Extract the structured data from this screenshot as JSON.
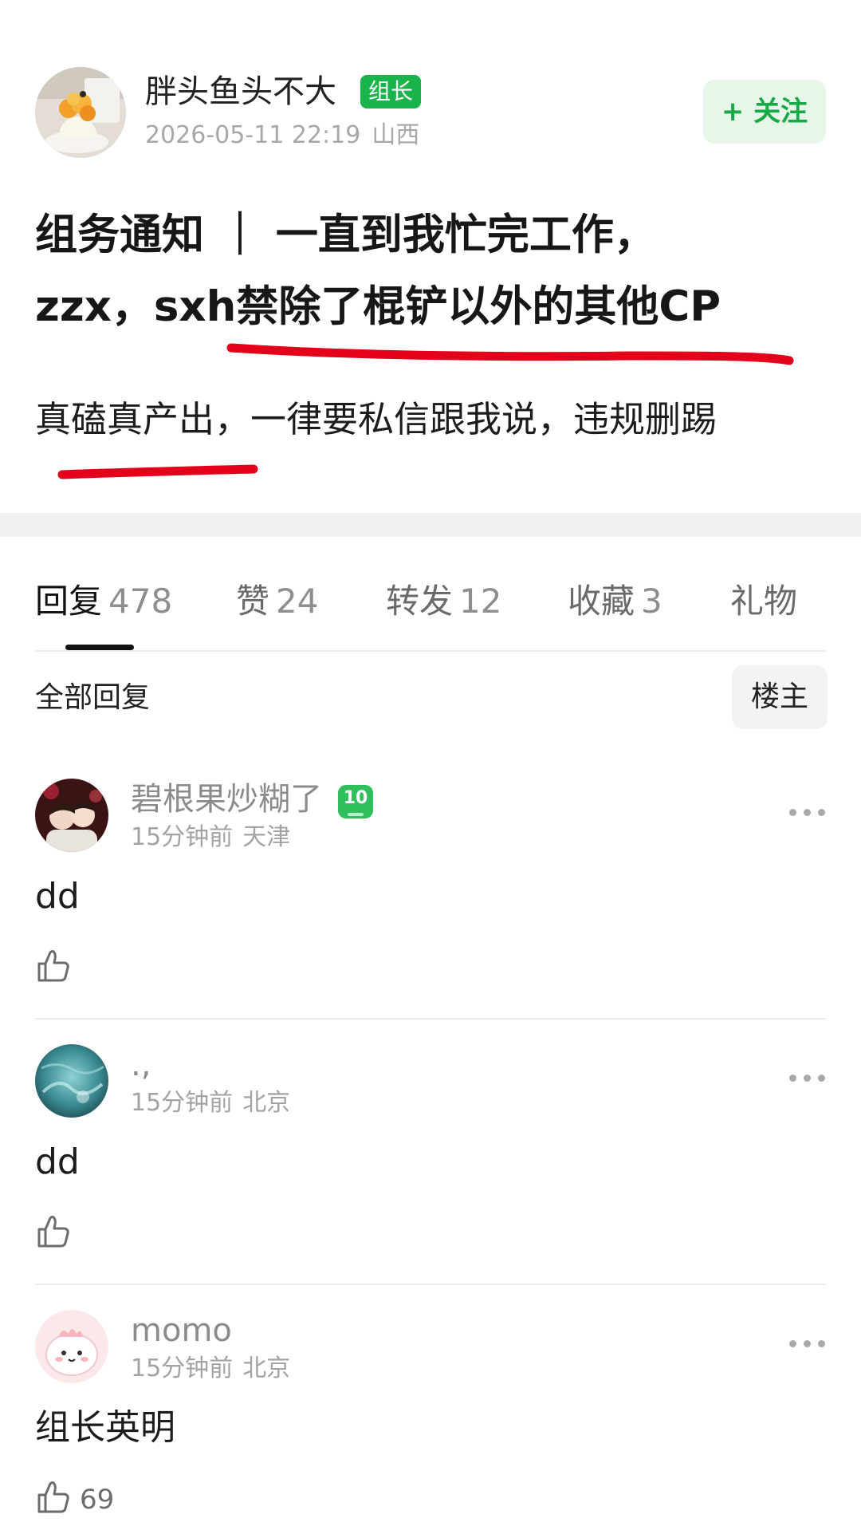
{
  "author": {
    "name": "胖头鱼头不大",
    "badge": "组长",
    "datetime": "2026-05-11 22:19",
    "location": "山西",
    "follow_label": "+ 关注"
  },
  "post": {
    "title_line1": "组务通知 ｜ 一直到我忙完工作，",
    "title_line2": "zzx，sxh禁除了棍铲以外的其他CP",
    "content": "真磕真产出，一律要私信跟我说，违规删踢"
  },
  "tabs": [
    {
      "label": "回复",
      "count": "478",
      "active": true
    },
    {
      "label": "赞",
      "count": "24",
      "active": false
    },
    {
      "label": "转发",
      "count": "12",
      "active": false
    },
    {
      "label": "收藏",
      "count": "3",
      "active": false
    },
    {
      "label": "礼物",
      "count": "",
      "active": false
    }
  ],
  "replies": {
    "title": "全部回复",
    "op_filter_label": "楼主"
  },
  "comments": [
    {
      "name": "碧根果炒糊了",
      "level": "10",
      "time": "15分钟前",
      "location": "天津",
      "text": "dd",
      "likes": ""
    },
    {
      "name": ".,",
      "level": "",
      "time": "15分钟前",
      "location": "北京",
      "text": "dd",
      "likes": ""
    },
    {
      "name": "momo",
      "level": "",
      "time": "15分钟前",
      "location": "北京",
      "text": "组长英明",
      "likes": "69"
    }
  ],
  "colors": {
    "brand_green": "#19b44a",
    "follow_bg": "#e6f7ea",
    "annotation_red": "#e3001b"
  }
}
